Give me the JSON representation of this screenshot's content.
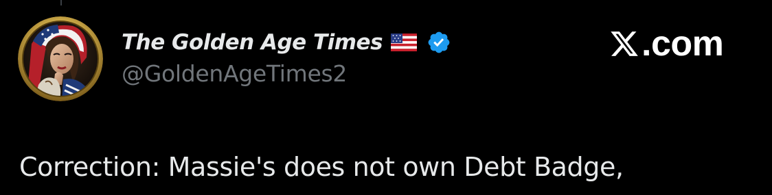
{
  "tweet": {
    "author": {
      "display_name": "The Golden Age Times",
      "handle": "@GoldenAgeTimes2",
      "flag_icon": "us-flag-icon",
      "verified_icon": "verified-badge-icon"
    },
    "source": {
      "logo_icon": "x-logo-icon",
      "site_suffix": ".com"
    },
    "text": "Correction: Massie's does not own Debt Badge,"
  },
  "colors": {
    "background": "#000000",
    "primary_text": "#e7e9ea",
    "secondary_text": "#71767b",
    "verified_blue": "#1d9bf0",
    "avatar_gold": "#c9a646"
  }
}
